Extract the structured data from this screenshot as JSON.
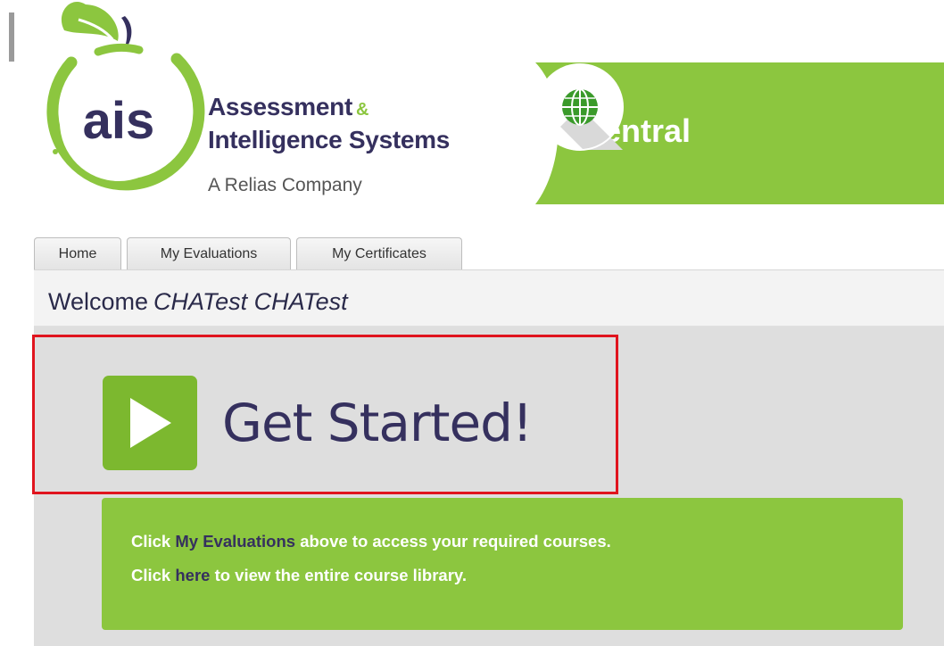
{
  "brand": {
    "logo_text": "ais",
    "name_line1": "Assessment",
    "name_amp": "&",
    "name_line2": "Intelligence Systems",
    "subtitle": "A Relias Company",
    "central_label": "Central"
  },
  "tabs": [
    {
      "label": "Home"
    },
    {
      "label": "My Evaluations"
    },
    {
      "label": "My Certificates"
    }
  ],
  "welcome": {
    "prefix": "Welcome",
    "user_name": "CHATest CHATest"
  },
  "get_started": {
    "label": "Get Started!"
  },
  "info": {
    "line1_prefix": "Click",
    "line1_link": "My Evaluations",
    "line1_suffix": "above to access your required courses.",
    "line2_prefix": "Click",
    "line2_link": "here",
    "line2_suffix": "to view the entire course library."
  },
  "colors": {
    "brand_green": "#8cc63f",
    "brand_navy": "#35305e",
    "highlight_red": "#e0141e",
    "panel_gray": "#dedede"
  },
  "icons": [
    "play-icon",
    "globe-icon",
    "apple-leaf-icon"
  ]
}
